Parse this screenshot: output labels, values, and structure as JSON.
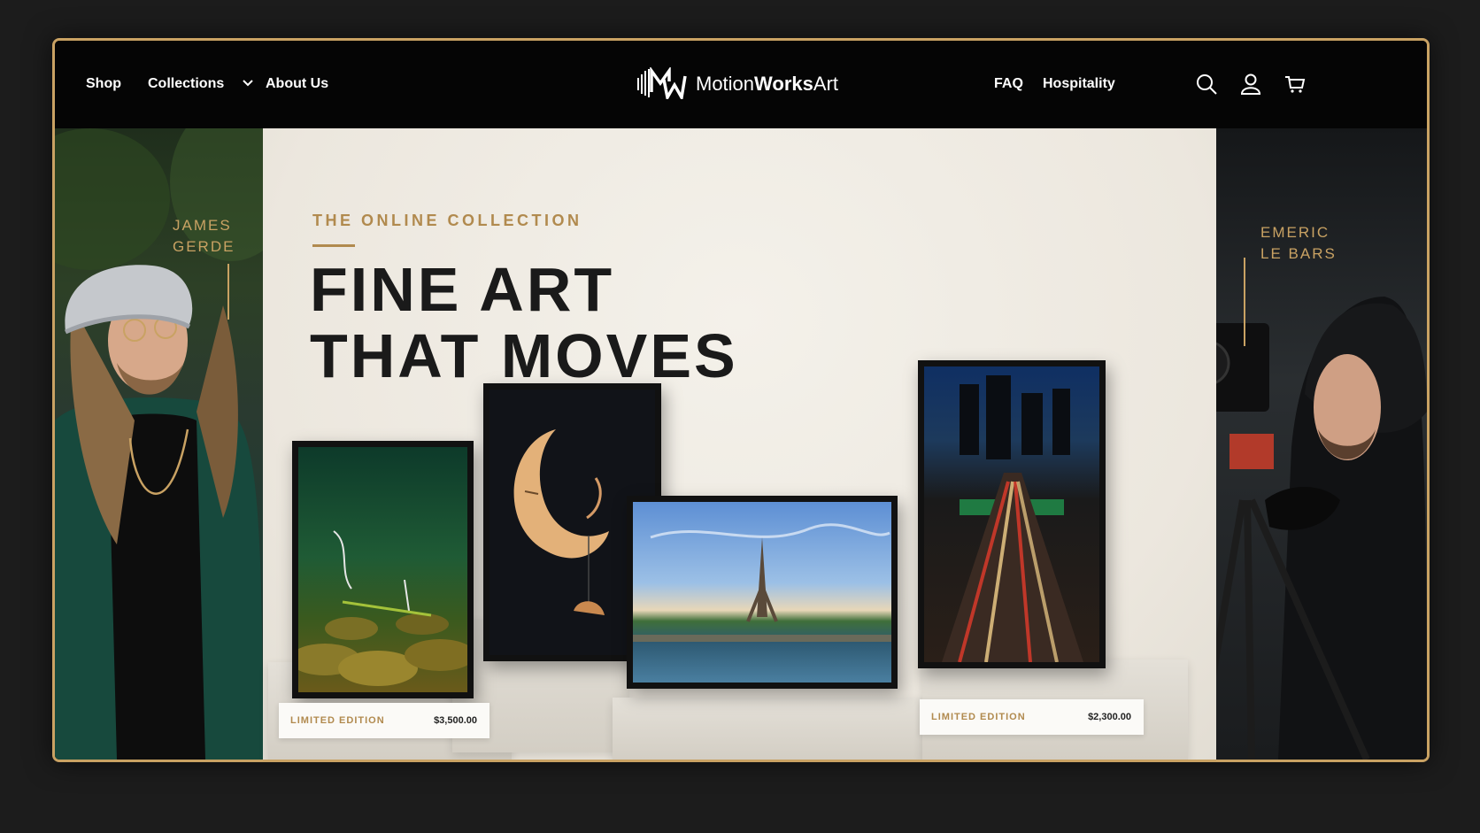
{
  "header": {
    "nav_left": [
      "Shop",
      "Collections",
      "About Us"
    ],
    "logo": {
      "text_regular_1": "Motion",
      "text_bold": "Works",
      "text_regular_2": "Art"
    },
    "nav_right": [
      "FAQ",
      "Hospitality"
    ],
    "icons": [
      "search-icon",
      "account-icon",
      "cart-icon"
    ]
  },
  "hero": {
    "eyebrow": "THE ONLINE COLLECTION",
    "headline_line1": "FINE ART",
    "headline_line2": "THAT MOVES",
    "artist_left": {
      "first": "JAMES",
      "last": "GERDE"
    },
    "artist_right": {
      "first": "EMERIC",
      "last": "LE BARS"
    }
  },
  "products": [
    {
      "label": "LIMITED EDITION",
      "price": "$3,500.00"
    },
    {
      "label": "LIMITED EDITION",
      "price": "$2,300.00"
    }
  ],
  "colors": {
    "accent_gold": "#c9a263",
    "background": "#1c1c1c",
    "header": "#050505",
    "center_bg": "#f1ede5"
  }
}
